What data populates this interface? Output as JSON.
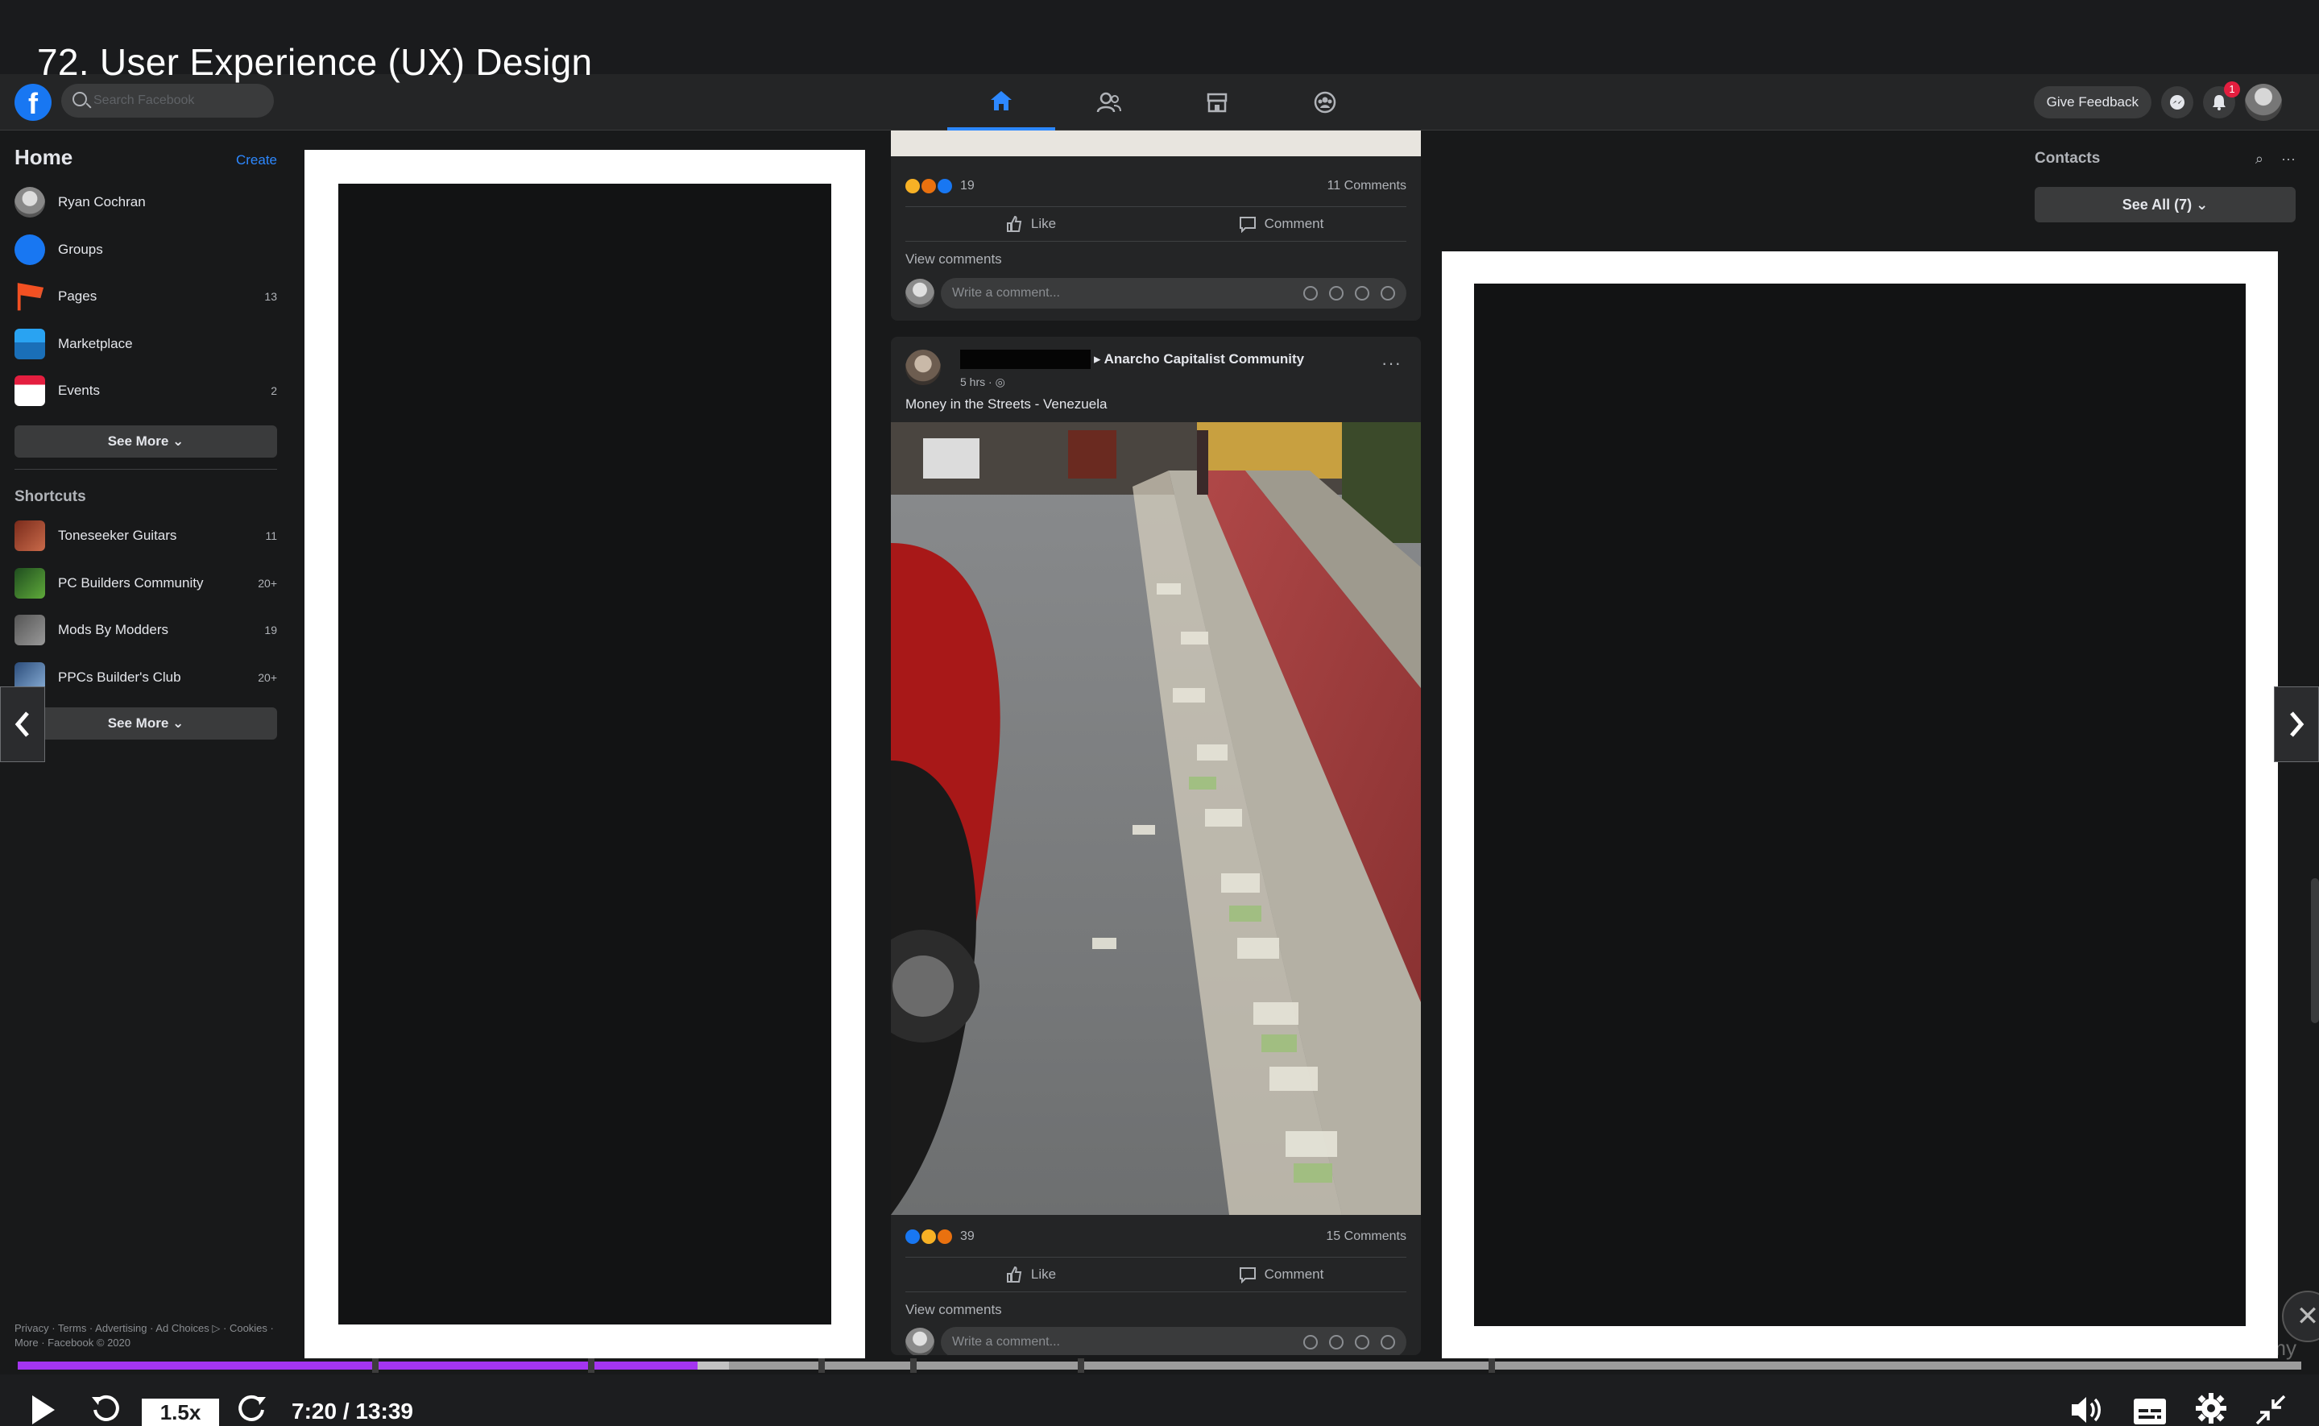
{
  "course": {
    "title": "72. User Experience (UX) Design"
  },
  "fb_header": {
    "logo": "f",
    "search_placeholder": "Search Facebook",
    "nav_tabs": [
      "home-icon",
      "friends-icon",
      "marketplace-icon",
      "groups-icon"
    ],
    "give_feedback": "Give Feedback",
    "notification_count": "1"
  },
  "sidebar": {
    "home": "Home",
    "create": "Create",
    "items": [
      {
        "label": "Ryan Cochran",
        "count": ""
      },
      {
        "label": "Groups",
        "count": ""
      },
      {
        "label": "Pages",
        "count": "13"
      },
      {
        "label": "Marketplace",
        "count": ""
      },
      {
        "label": "Events",
        "count": "2"
      }
    ],
    "see_more": "See More",
    "shortcuts_title": "Shortcuts",
    "shortcuts": [
      {
        "label": "Toneseeker Guitars",
        "count": "11"
      },
      {
        "label": "PC Builders Community",
        "count": "20+"
      },
      {
        "label": "Mods By Modders",
        "count": "19"
      },
      {
        "label": "PPCs Builder's Club",
        "count": "20+"
      }
    ],
    "see_more_2": "See More",
    "footer": "Privacy · Terms · Advertising · Ad Choices ▷ · Cookies · More · Facebook © 2020"
  },
  "feed": {
    "post1": {
      "reactions_count": "19",
      "comments": "11 Comments",
      "like": "Like",
      "comment": "Comment",
      "view_comments": "View comments",
      "write_comment": "Write a comment..."
    },
    "post2": {
      "group": "Anarcho Capitalist Community",
      "time": "5 hrs",
      "text": "Money in the Streets - Venezuela",
      "reactions_count": "39",
      "comments": "15 Comments",
      "like": "Like",
      "comment": "Comment",
      "view_comments": "View comments",
      "write_comment": "Write a comment..."
    }
  },
  "contacts": {
    "title": "Contacts",
    "see_all": "See All (7)"
  },
  "player": {
    "speed": "1.5x",
    "time": "7:20 / 13:39",
    "progress": 0.2977,
    "buffered": 0.3115,
    "watermark": "Udemy",
    "colors": {
      "progress": "#a435f0",
      "track": "#9c9c9c"
    }
  }
}
